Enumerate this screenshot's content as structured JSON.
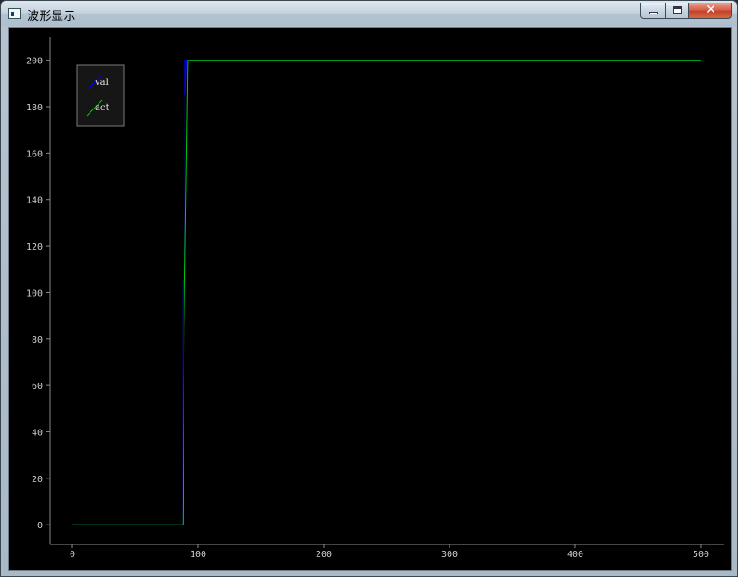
{
  "window": {
    "title": "波形显示",
    "close_glyph": "✕"
  },
  "chart_data": {
    "type": "line",
    "title": "",
    "xlabel": "",
    "ylabel": "",
    "xlim": [
      -18,
      518
    ],
    "ylim": [
      -8.5,
      210
    ],
    "xticks": [
      0,
      100,
      200,
      300,
      400,
      500
    ],
    "yticks": [
      0,
      20,
      40,
      60,
      80,
      100,
      120,
      140,
      160,
      180,
      200
    ],
    "grid": false,
    "legend_position": "top-left",
    "series": [
      {
        "name": "val",
        "color": "#0000ff",
        "x": [
          0,
          88,
          88,
          89,
          89,
          90,
          90,
          91,
          500
        ],
        "y": [
          0,
          0,
          105,
          105,
          200,
          200,
          185,
          200,
          200
        ]
      },
      {
        "name": "act",
        "color": "#00cc00",
        "x": [
          0,
          88,
          89,
          92,
          500
        ],
        "y": [
          0,
          0,
          85,
          200,
          200
        ]
      }
    ]
  }
}
